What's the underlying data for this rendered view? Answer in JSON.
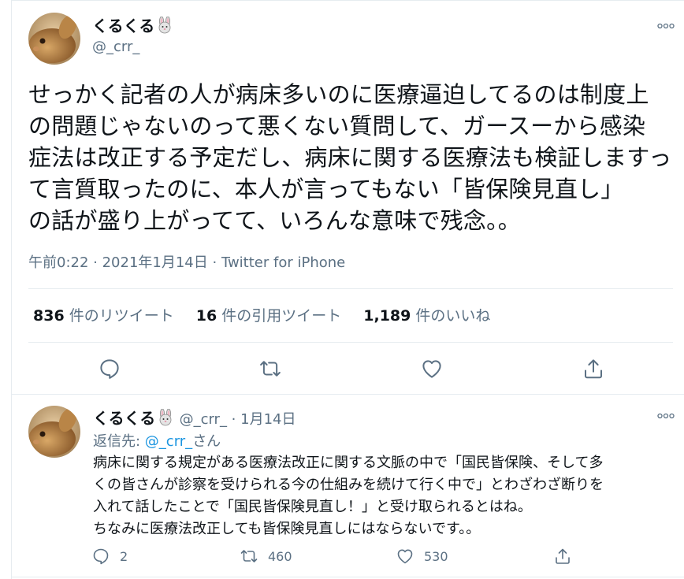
{
  "colors": {
    "text": "#0f1419",
    "secondary": "#5b7083",
    "link": "#1b95e0",
    "divider": "#e6ecf0"
  },
  "tweet": {
    "display_name": "くるくる",
    "name_emoji_icon": "rabbit-face-icon",
    "handle": "@_crr_",
    "text": "せっかく記者の人が病床多いのに医療逼迫してるのは制度上\nの問題じゃないのって悪くない質問して、ガースーから感染\n症法は改正する予定だし、病床に関する医療法も検証しますって言質取ったのに、本人が言ってもない「皆保険見直し」\nの話が盛り上がってて、いろんな意味で残念。。",
    "timestamp": "午前0:22 · 2021年1月14日",
    "separator": " · ",
    "source": "Twitter for iPhone",
    "stats": {
      "retweets_count": "836",
      "retweets_label": "件のリツイート",
      "quotes_count": "16",
      "quotes_label": "件の引用ツイート",
      "likes_count": "1,189",
      "likes_label": "件のいいね"
    },
    "actions": [
      "reply-icon",
      "retweet-icon",
      "like-icon",
      "share-icon"
    ]
  },
  "reply": {
    "display_name": "くるくる",
    "handle": "@_crr_",
    "date": "1月14日",
    "dot": " · ",
    "reply_to_prefix": "返信先: ",
    "reply_to_handle": "@_crr_",
    "reply_to_suffix": "さん",
    "text": "病床に関する規定がある医療法改正に関する文脈の中で「国民皆保険、そして多\nくの皆さんが診察を受けられる今の仕組みを続けて行く中で」とわざわざ断りを\n入れて話したことで「国民皆保険見直し！」と受け取られるとはね。\nちなみに医療法改正しても皆保険見直しにはならないです。。",
    "reply_count": "2",
    "retweet_count": "460",
    "like_count": "530"
  }
}
